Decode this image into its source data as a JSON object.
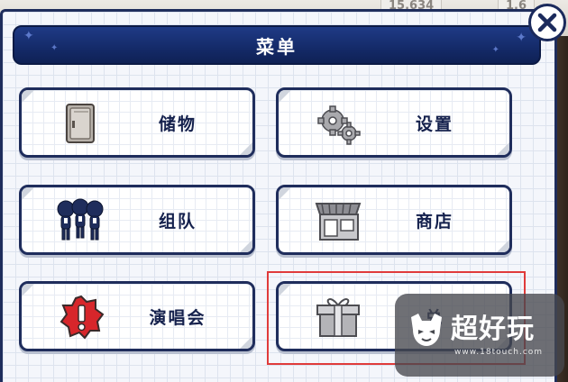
{
  "background": {
    "counter_left": "15,634",
    "counter_right": "1,6"
  },
  "menu": {
    "title": "菜单",
    "close_symbol": "✕"
  },
  "items": [
    {
      "label": "储物",
      "icon": "locker-icon"
    },
    {
      "label": "设置",
      "icon": "gears-icon"
    },
    {
      "label": "组队",
      "icon": "party-icon"
    },
    {
      "label": "商店",
      "icon": "shop-icon"
    },
    {
      "label": "演唱会",
      "icon": "concert-alert-icon"
    },
    {
      "label": "兑",
      "icon": "gift-box-icon"
    }
  ],
  "watermark": {
    "title": "超好玩",
    "url": "www.18touch.com"
  },
  "colors": {
    "navy": "#1f2d5c",
    "title_bar": "#1f3a86",
    "highlight": "#e03b3b",
    "concert_red": "#d7262b"
  }
}
